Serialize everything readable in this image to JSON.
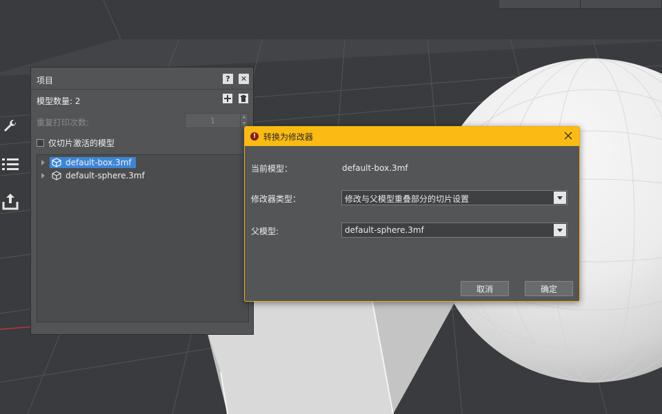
{
  "panel": {
    "title": "项目",
    "help_label": "?",
    "close_label": "✕",
    "model_count_label": "模型数量: 2",
    "repeat_print_label": "重复打印次数:",
    "repeat_print_value": "1",
    "checkbox_label": "仅切片激活的模型",
    "models": [
      {
        "name": "default-box.3mf",
        "selected": true
      },
      {
        "name": "default-sphere.3mf",
        "selected": false
      }
    ]
  },
  "dialog": {
    "title": "转换为修改器",
    "warning_glyph": "!",
    "current_model_label": "当前模型：",
    "current_model_value": "default-box.3mf",
    "modifier_type_label": "修改器类型：",
    "modifier_type_value": "修改与父模型重叠部分的切片设置",
    "parent_model_label": "父模型:",
    "parent_model_value": "default-sphere.3mf",
    "cancel_label": "取消",
    "ok_label": "确定"
  },
  "colors": {
    "dialog_header": "#fbbb12",
    "dialog_border": "#f2ad1f",
    "selection": "#3d86d6",
    "warning": "#8b1a12"
  }
}
